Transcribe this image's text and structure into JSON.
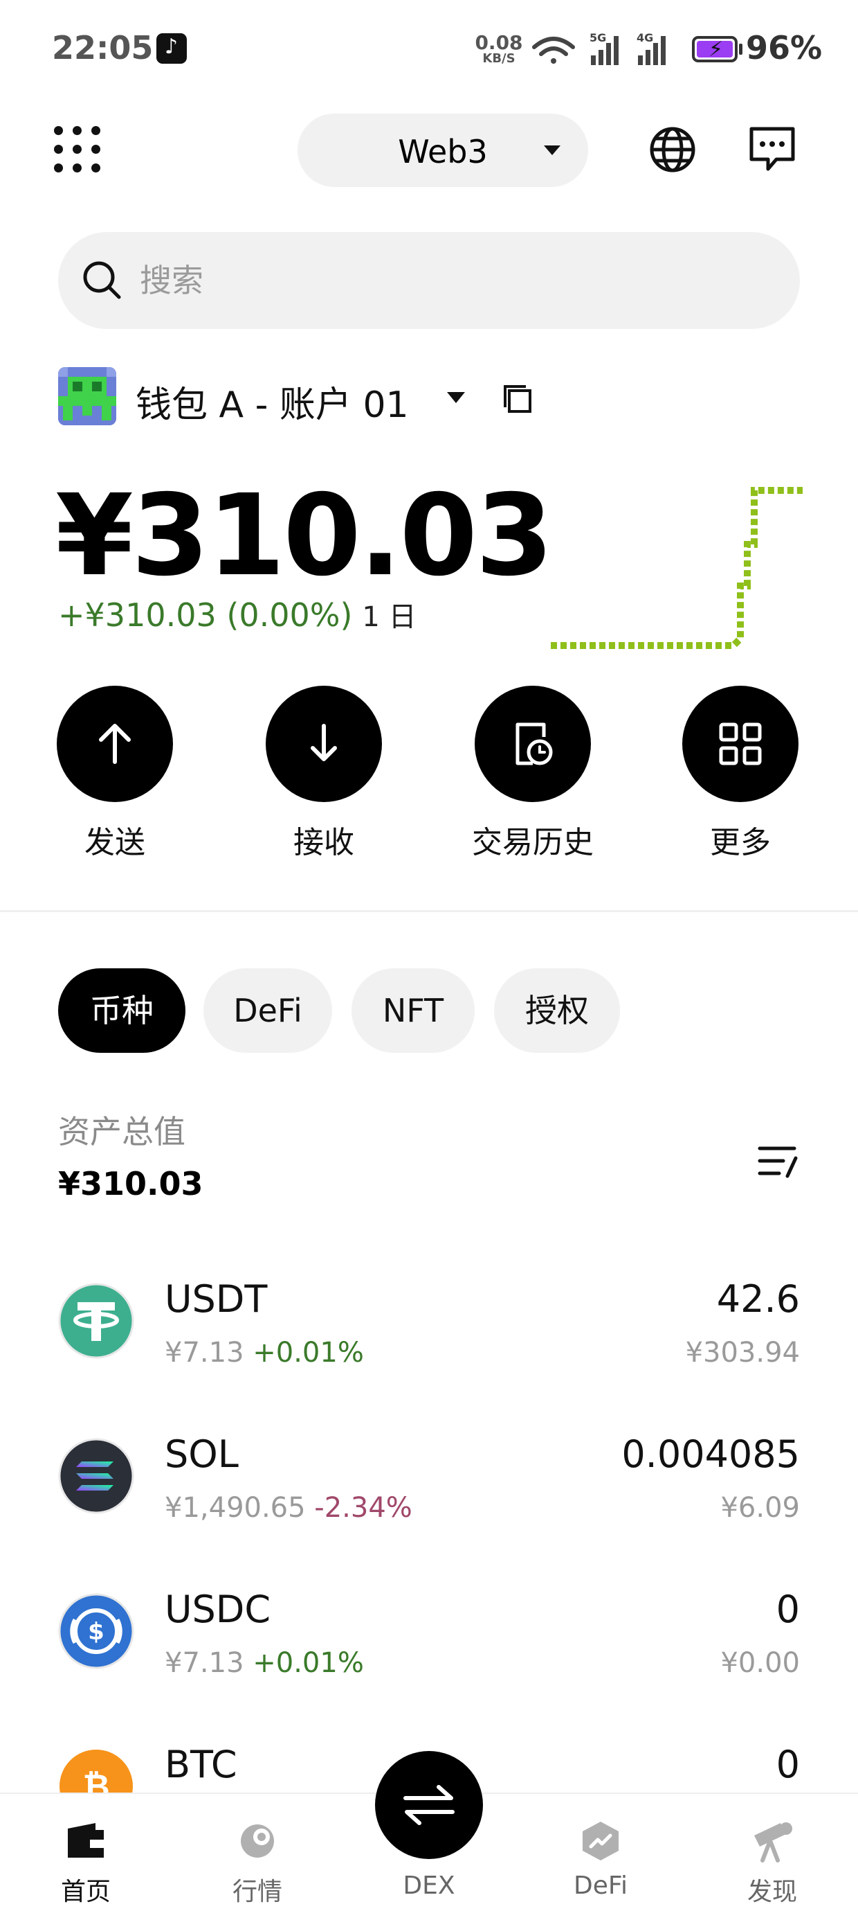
{
  "status_bar": {
    "time": "22:05",
    "net_speed": "0.08",
    "net_speed_unit": "KB/S",
    "net_5g": "5G",
    "net_4g": "4G",
    "battery": "96%"
  },
  "header": {
    "network_label": "Web3"
  },
  "search": {
    "placeholder": "搜索"
  },
  "wallet": {
    "name": "钱包 A - 账户 01",
    "balance": "¥310.03",
    "change": "+¥310.03 (0.00%)",
    "period": "1 日"
  },
  "actions": [
    {
      "label": "发送",
      "icon": "arrow-up-icon"
    },
    {
      "label": "接收",
      "icon": "arrow-down-icon"
    },
    {
      "label": "交易历史",
      "icon": "history-icon"
    },
    {
      "label": "更多",
      "icon": "grid-icon"
    }
  ],
  "tabs": [
    {
      "label": "币种",
      "active": true
    },
    {
      "label": "DeFi",
      "active": false
    },
    {
      "label": "NFT",
      "active": false
    },
    {
      "label": "授权",
      "active": false
    }
  ],
  "assets": {
    "title": "资产总值",
    "total": "¥310.03"
  },
  "tokens": [
    {
      "symbol": "USDT",
      "price": "¥7.13",
      "change": "+0.01%",
      "direction": "up",
      "amount": "42.6",
      "value": "¥303.94",
      "color": "#3daf8f"
    },
    {
      "symbol": "SOL",
      "price": "¥1,490.65",
      "change": "-2.34%",
      "direction": "down",
      "amount": "0.004085",
      "value": "¥6.09",
      "color": "#2b2f38"
    },
    {
      "symbol": "USDC",
      "price": "¥7.13",
      "change": "+0.01%",
      "direction": "up",
      "amount": "0",
      "value": "¥0.00",
      "color": "#2f72d1"
    },
    {
      "symbol": "BTC",
      "price": "",
      "change": "",
      "direction": "up",
      "amount": "0",
      "value": "",
      "color": "#f7931a"
    }
  ],
  "bottom_nav": [
    {
      "label": "首页",
      "icon": "wallet-icon",
      "active": true
    },
    {
      "label": "行情",
      "icon": "market-icon",
      "active": false
    },
    {
      "label": "DEX",
      "icon": "swap-icon",
      "active": false
    },
    {
      "label": "DeFi",
      "icon": "defi-icon",
      "active": false
    },
    {
      "label": "发现",
      "icon": "telescope-icon",
      "active": false
    }
  ],
  "colors": {
    "positive": "#3a7a2a",
    "negative": "#a0486a",
    "sparkline": "#8fbf1a",
    "pill_bg": "#f1f1f1"
  }
}
